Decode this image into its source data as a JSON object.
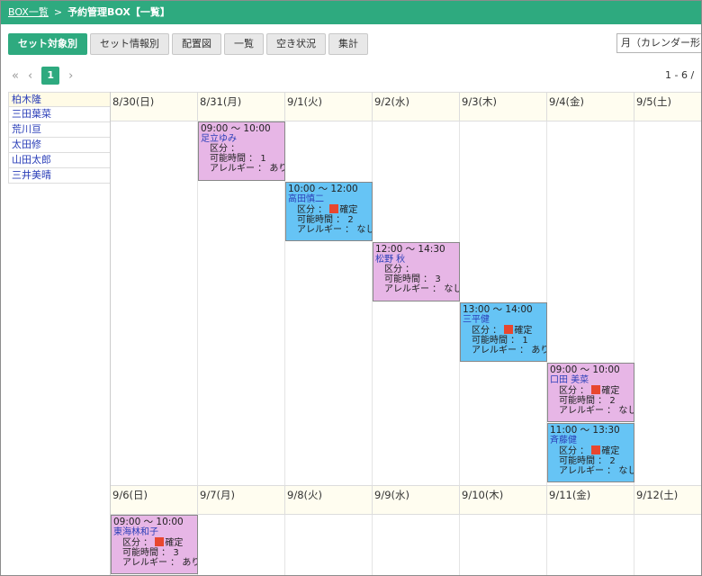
{
  "breadcrumb": {
    "parent": "BOX一覧",
    "separator": ">",
    "current": "予約管理BOX【一覧】"
  },
  "tabs": [
    {
      "label": "セット対象別",
      "active": true
    },
    {
      "label": "セット情報別",
      "active": false
    },
    {
      "label": "配置図",
      "active": false
    },
    {
      "label": "一覧",
      "active": false
    },
    {
      "label": "空き状況",
      "active": false
    },
    {
      "label": "集計",
      "active": false
    }
  ],
  "view_select": {
    "value": "月（カレンダー形"
  },
  "pager": {
    "first": "«",
    "prev": "‹",
    "page": "1",
    "next": "›",
    "range": "1 - 6 /"
  },
  "people": [
    "柏木隆",
    "三田葉菜",
    "荒川亘",
    "太田修",
    "山田太郎",
    "三井美晴"
  ],
  "weeks": [
    {
      "days": [
        "8/30(日)",
        "8/31(月)",
        "9/1(火)",
        "9/2(水)",
        "9/3(木)",
        "9/4(金)",
        "9/5(土)"
      ]
    },
    {
      "days": [
        "9/6(日)",
        "9/7(月)",
        "9/8(火)",
        "9/9(水)",
        "9/10(木)",
        "9/11(金)",
        "9/12(土)"
      ]
    }
  ],
  "labels": {
    "kubun": "区分 ：",
    "kanou": "可能時間 ：",
    "allergy": "アレルギー ："
  },
  "colors": {
    "accent": "#2eaa7f",
    "event_pink": "#e7b6e6",
    "event_blue": "#66c4f5",
    "confirmed_mark": "#e8472f"
  },
  "events": [
    {
      "week": 0,
      "day": 1,
      "slot": 0,
      "color": "pink",
      "time": "09:00 ～ 10:00",
      "name": "足立ゆみ",
      "status": "",
      "hours": "1",
      "allergy": "あり"
    },
    {
      "week": 0,
      "day": 2,
      "slot": 1,
      "color": "blue",
      "time": "10:00 ～ 12:00",
      "name": "高田慎二",
      "status": "確定",
      "hours": "2",
      "allergy": "なし"
    },
    {
      "week": 0,
      "day": 3,
      "slot": 2,
      "color": "pink",
      "time": "12:00 ～ 14:30",
      "name": "松野 秋",
      "status": "",
      "hours": "3",
      "allergy": "なし"
    },
    {
      "week": 0,
      "day": 4,
      "slot": 3,
      "color": "blue",
      "time": "13:00 ～ 14:00",
      "name": "三平健",
      "status": "確定",
      "hours": "1",
      "allergy": "あり"
    },
    {
      "week": 0,
      "day": 5,
      "slot": 4,
      "color": "pink",
      "time": "09:00 ～ 10:00",
      "name": "口田 美菜",
      "status": "確定",
      "hours": "2",
      "allergy": "なし"
    },
    {
      "week": 0,
      "day": 5,
      "slot": 5,
      "color": "blue",
      "time": "11:00 ～ 13:30",
      "name": "斉藤健",
      "status": "確定",
      "hours": "2",
      "allergy": "なし"
    },
    {
      "week": 1,
      "day": 0,
      "slot": 0,
      "color": "pink",
      "time": "09:00 ～ 10:00",
      "name": "東海林和子",
      "status": "確定",
      "hours": "3",
      "allergy": "あり"
    }
  ]
}
